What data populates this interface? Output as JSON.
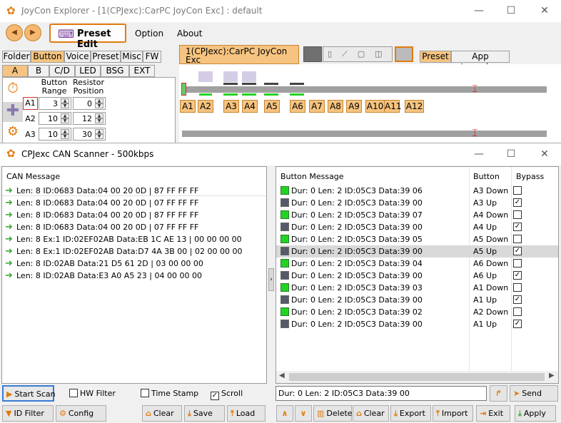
{
  "main": {
    "title": "JoyCon Explorer - [1(CPJexc):CarPC JoyCon Exc] : default",
    "menu": {
      "preset_edit": "Preset Edit",
      "option": "Option",
      "about": "About"
    },
    "top_tabs": [
      "Folder",
      "Button",
      "Voice",
      "Preset",
      "Misc",
      "FW"
    ],
    "sub_tabs": [
      "A",
      "B",
      "C/D",
      "LED",
      "BSG",
      "EXT"
    ],
    "col_button_range": "Button\nRange",
    "col_resistor": "Resistor\nPosition",
    "rows": [
      {
        "label": "A1",
        "range": "3",
        "pos": "0"
      },
      {
        "label": "A2",
        "range": "10",
        "pos": "12"
      },
      {
        "label": "A3",
        "range": "10",
        "pos": "30"
      }
    ],
    "device_tab": "1(CPJexc):CarPC JoyCon Exc",
    "device_sub": "default",
    "right_tabs": [
      "Preset",
      "App Launcher"
    ],
    "slots": [
      "A1",
      "A2",
      "A3",
      "A4",
      "A5",
      "A6",
      "A7",
      "A8",
      "A9",
      "A10",
      "A11",
      "A12"
    ]
  },
  "scanner": {
    "title": "CPJexc CAN Scanner - 500kbps",
    "can_header": "CAN Message",
    "can_messages": [
      "Len: 8 ID:0683 Data:04 00 20 0D | 87 FF FF FF",
      "Len: 8 ID:0683 Data:04 00 20 0D | 07 FF FF FF",
      "Len: 8 ID:0683 Data:04 00 20 0D | 87 FF FF FF",
      "Len: 8 ID:0683 Data:04 00 20 0D | 07 FF FF FF",
      "Len: 8 Ex:1 ID:02EF02AB Data:EB 1C AE 13 | 00 00 00 00",
      "Len: 8 Ex:1 ID:02EF02AB Data:D7 4A 3B 00 | 02 00 00 00",
      "Len: 8 ID:02AB Data:21 D5 61 2D | 03 00 00 00",
      "Len: 8 ID:02AB Data:E3 A0 A5 23 | 04 00 00 00"
    ],
    "btn_headers": {
      "message": "Button Message",
      "button": "Button",
      "bypass": "Bypass"
    },
    "button_messages": [
      {
        "msg": "Dur:  0 Len: 2 ID:05C3 Data:39 06",
        "button": "A3 Down",
        "bypass": false,
        "state": "g"
      },
      {
        "msg": "Dur:  0 Len: 2 ID:05C3 Data:39 00",
        "button": "A3 Up",
        "bypass": true,
        "state": "d"
      },
      {
        "msg": "Dur:  0 Len: 2 ID:05C3 Data:39 07",
        "button": "A4 Down",
        "bypass": false,
        "state": "g"
      },
      {
        "msg": "Dur:  0 Len: 2 ID:05C3 Data:39 00",
        "button": "A4 Up",
        "bypass": true,
        "state": "d"
      },
      {
        "msg": "Dur:  0 Len: 2 ID:05C3 Data:39 05",
        "button": "A5 Down",
        "bypass": false,
        "state": "g"
      },
      {
        "msg": "Dur:  0 Len: 2 ID:05C3 Data:39 00",
        "button": "A5 Up",
        "bypass": true,
        "state": "d"
      },
      {
        "msg": "Dur:  0 Len: 2 ID:05C3 Data:39 04",
        "button": "A6 Down",
        "bypass": false,
        "state": "g"
      },
      {
        "msg": "Dur:  0 Len: 2 ID:05C3 Data:39 00",
        "button": "A6 Up",
        "bypass": true,
        "state": "d"
      },
      {
        "msg": "Dur:  0 Len: 2 ID:05C3 Data:39 03",
        "button": "A1 Down",
        "bypass": false,
        "state": "g"
      },
      {
        "msg": "Dur:  0 Len: 2 ID:05C3 Data:39 00",
        "button": "A1 Up",
        "bypass": true,
        "state": "d"
      },
      {
        "msg": "Dur:  0 Len: 2 ID:05C3 Data:39 02",
        "button": "A2 Down",
        "bypass": false,
        "state": "g"
      },
      {
        "msg": "Dur:  0 Len: 2 ID:05C3 Data:39 00",
        "button": "A1 Up",
        "bypass": true,
        "state": "d"
      }
    ],
    "selected_row": 5,
    "send_text": "Dur:  0 Len: 2 ID:05C3 Data:39 00",
    "buttons": {
      "start_scan": "Start Scan",
      "id_filter": "ID Filter",
      "config": "Config",
      "clear": "Clear",
      "save": "Save",
      "load": "Load",
      "delete": "Delete",
      "clear2": "Clear",
      "export": "Export",
      "import": "Import",
      "exit": "Exit",
      "apply": "Apply",
      "send": "Send"
    },
    "checks": {
      "hw_filter": {
        "label": "HW Filter",
        "checked": false
      },
      "time_stamp": {
        "label": "Time Stamp",
        "checked": false
      },
      "scroll": {
        "label": "Scroll",
        "checked": true
      }
    }
  },
  "colors": {
    "accent": "#e07b10",
    "tab_selected": "#f6c480",
    "green": "#22d422"
  }
}
